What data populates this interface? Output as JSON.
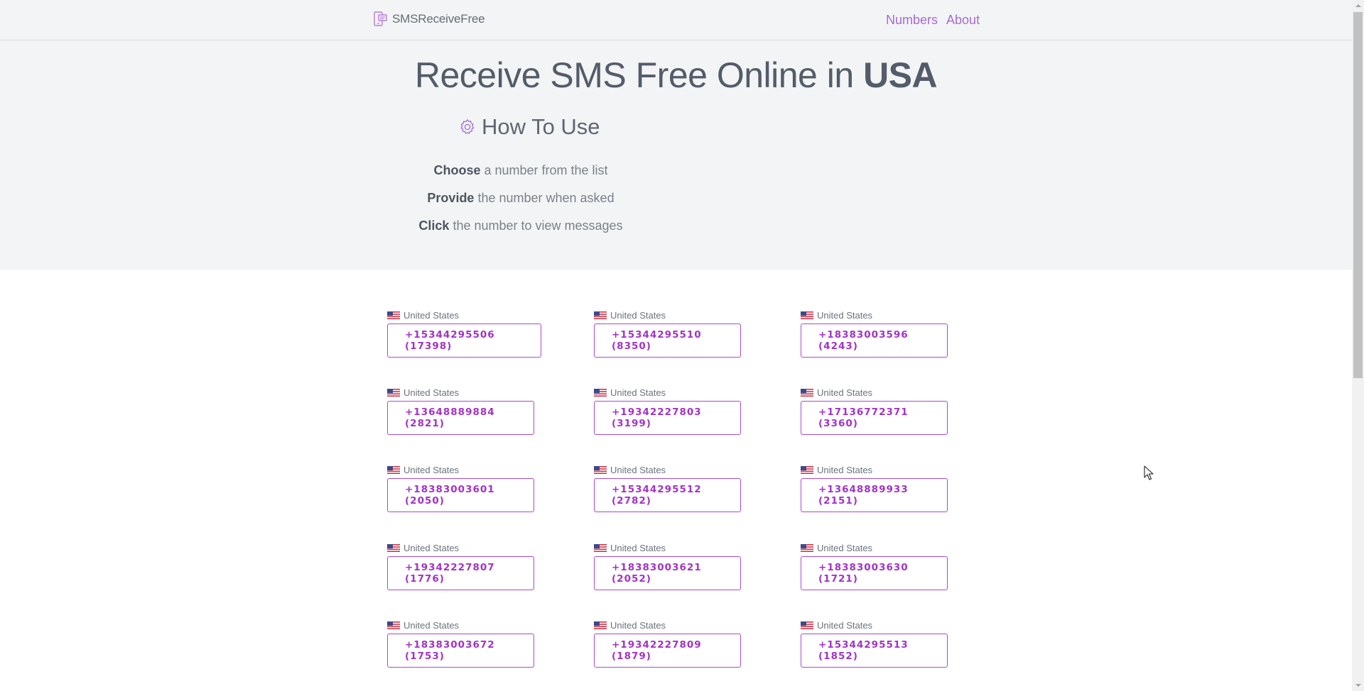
{
  "nav": {
    "brand": "SMSReceiveFree",
    "links": [
      "Numbers",
      "About"
    ],
    "accent": "#a56bd1"
  },
  "hero": {
    "title_prefix": "Receive SMS Free Online in ",
    "title_country": "USA",
    "howto_title": "How To Use",
    "steps": [
      {
        "bold": "Choose",
        "text": " a number from the list"
      },
      {
        "bold": "Provide",
        "text": " the number when asked"
      },
      {
        "bold": "Click",
        "text": " the number to view messages"
      }
    ]
  },
  "numbers": [
    {
      "country": "United States",
      "label": "+15344295506 (17398)"
    },
    {
      "country": "United States",
      "label": "+15344295510 (8350)"
    },
    {
      "country": "United States",
      "label": "+18383003596 (4243)"
    },
    {
      "country": "United States",
      "label": "+13648889884 (2821)"
    },
    {
      "country": "United States",
      "label": "+19342227803 (3199)"
    },
    {
      "country": "United States",
      "label": "+17136772371 (3360)"
    },
    {
      "country": "United States",
      "label": "+18383003601 (2050)"
    },
    {
      "country": "United States",
      "label": "+15344295512 (2782)"
    },
    {
      "country": "United States",
      "label": "+13648889933 (2151)"
    },
    {
      "country": "United States",
      "label": "+19342227807 (1776)"
    },
    {
      "country": "United States",
      "label": "+18383003621 (2052)"
    },
    {
      "country": "United States",
      "label": "+18383003630 (1721)"
    },
    {
      "country": "United States",
      "label": "+18383003672 (1753)"
    },
    {
      "country": "United States",
      "label": "+19342227809 (1879)"
    },
    {
      "country": "United States",
      "label": "+15344295513 (1852)"
    }
  ],
  "colors": {
    "button_border": "#a64bd0",
    "button_text": "#a232c8",
    "hero_bg": "#f3f4f6"
  }
}
